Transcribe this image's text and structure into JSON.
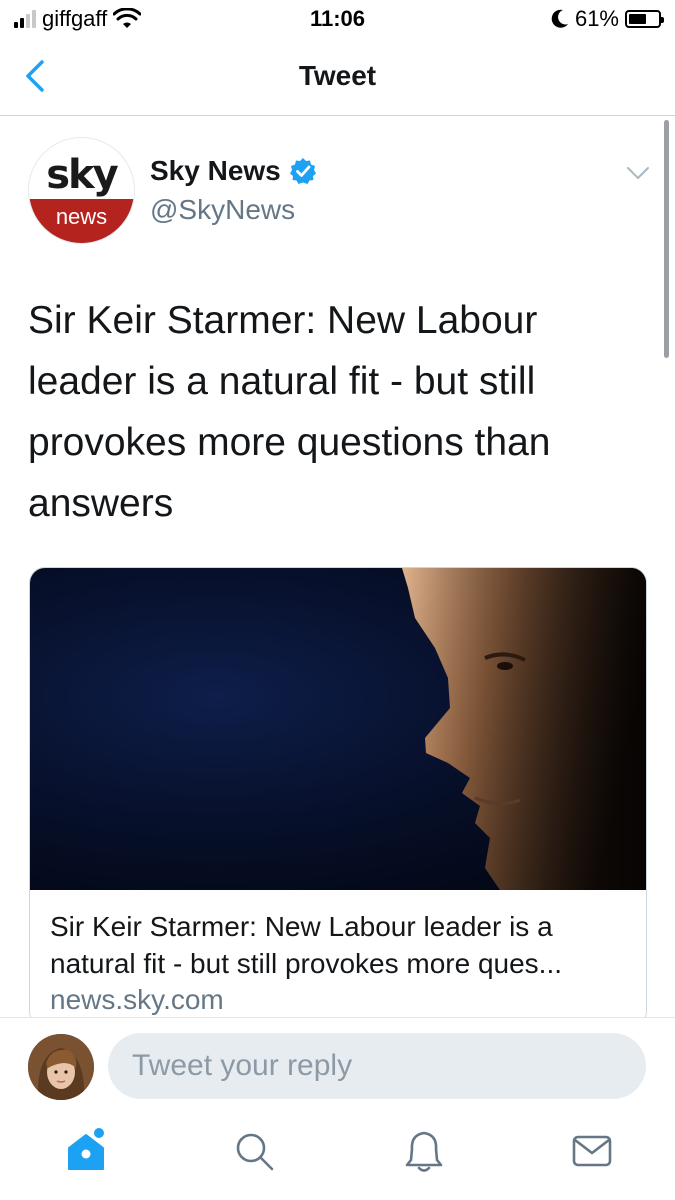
{
  "status_bar": {
    "carrier": "giffgaff",
    "time": "11:06",
    "battery_percent": "61%",
    "battery_level": 0.61,
    "icons": [
      "signal-icon",
      "wifi-icon",
      "moon-icon",
      "battery-icon"
    ]
  },
  "nav": {
    "title": "Tweet",
    "back_icon": "chevron-left-icon"
  },
  "tweet": {
    "author": {
      "name": "Sky News",
      "handle": "@SkyNews",
      "verified": true,
      "avatar_logo_top": "sky",
      "avatar_logo_bottom": "news"
    },
    "text": "Sir Keir Starmer: New Labour leader is a natural fit - but still provokes more questions than answers",
    "card": {
      "title": "Sir Keir Starmer: New Labour leader is a natural fit - but still provokes more ques...",
      "domain": "news.sky.com"
    }
  },
  "reply": {
    "placeholder": "Tweet your reply"
  },
  "tab_bar": {
    "items": [
      "home-icon",
      "search-icon",
      "notifications-icon",
      "messages-icon"
    ],
    "active": "home-icon"
  },
  "colors": {
    "accent": "#1da1f2",
    "text_primary": "#14171a",
    "text_secondary": "#657786",
    "sky_red": "#b5231e"
  }
}
